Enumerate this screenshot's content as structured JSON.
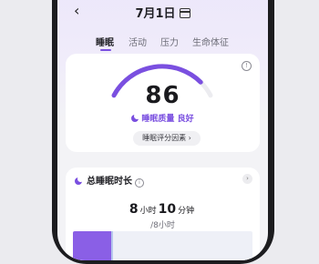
{
  "header": {
    "back_glyph": "‹",
    "date": "7月1日",
    "calendar_icon": "calendar-icon"
  },
  "tabs": [
    {
      "label": "睡眠",
      "active": true
    },
    {
      "label": "活动",
      "active": false
    },
    {
      "label": "压力",
      "active": false
    },
    {
      "label": "生命体征",
      "active": false
    }
  ],
  "score_card": {
    "score": "86",
    "score_value": 86,
    "score_max": 100,
    "quality_label": "睡眠质量",
    "quality_value": "良好",
    "factors_button": "睡眠评分因素 ›",
    "info_glyph": "!"
  },
  "duration_card": {
    "title": "总睡眠时长",
    "info_glyph": "i",
    "chevron": "›",
    "hours": "8",
    "hours_unit": "小时",
    "minutes": "10",
    "minutes_unit": "分钟",
    "goal": "/8小时"
  },
  "colors": {
    "accent": "#7a4fe0",
    "gauge_track": "#ececf0",
    "deep_sleep": "#8a5fe6",
    "light_sleep": "#b7c9ec"
  }
}
